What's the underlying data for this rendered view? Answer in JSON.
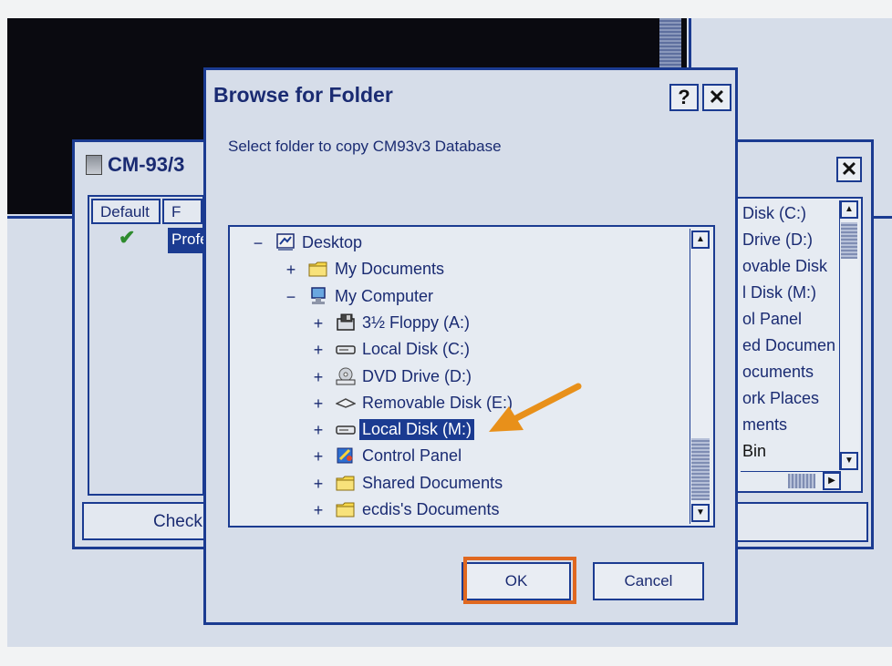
{
  "background_window": {
    "title": "CM-93/3",
    "close_label": "✕",
    "left_list": {
      "col_default": "Default",
      "col_second": "F",
      "check": "✔",
      "selected_cell": "Profe"
    },
    "check_button_label": "Check",
    "right_list_items": [
      "Disk (C:)",
      "Drive (D:)",
      "ovable Disk",
      "l Disk (M:)",
      "ol Panel",
      "ed Documen",
      "ocuments",
      "ork Places",
      "ments",
      "Bin"
    ],
    "scroll_up": "▲",
    "scroll_down": "▼",
    "scroll_right": "▶"
  },
  "dialog": {
    "title": "Browse for Folder",
    "help_label": "?",
    "close_label": "✕",
    "instruction": "Select folder to copy CM93v3 Database",
    "tree": [
      {
        "label": "Desktop",
        "toggle": "−",
        "icon": "desktop-icon",
        "selected": false
      },
      {
        "label": "My Documents",
        "toggle": "+",
        "icon": "folder-icon",
        "selected": false
      },
      {
        "label": "My Computer",
        "toggle": "−",
        "icon": "computer-icon",
        "selected": false
      },
      {
        "label": "3½ Floppy (A:)",
        "toggle": "+",
        "icon": "floppy-icon",
        "selected": false
      },
      {
        "label": "Local Disk (C:)",
        "toggle": "+",
        "icon": "drive-icon",
        "selected": false
      },
      {
        "label": "DVD Drive (D:)",
        "toggle": "+",
        "icon": "dvd-icon",
        "selected": false
      },
      {
        "label": "Removable Disk (E:)",
        "toggle": "+",
        "icon": "removable-disk-icon",
        "selected": false
      },
      {
        "label": "Local Disk (M:)",
        "toggle": "+",
        "icon": "drive-icon",
        "selected": true
      },
      {
        "label": "Control Panel",
        "toggle": "+",
        "icon": "control-panel-icon",
        "selected": false
      },
      {
        "label": "Shared Documents",
        "toggle": "+",
        "icon": "folder-icon",
        "selected": false
      },
      {
        "label": "ecdis's Documents",
        "toggle": "+",
        "icon": "folder-icon",
        "selected": false
      }
    ],
    "scroll_up": "▲",
    "scroll_down": "▼",
    "ok_label": "OK",
    "cancel_label": "Cancel"
  },
  "colors": {
    "border": "#1b3b91",
    "selection": "#1b3b91",
    "annotation_arrow": "#e8901a",
    "annotation_box": "#e06820"
  }
}
